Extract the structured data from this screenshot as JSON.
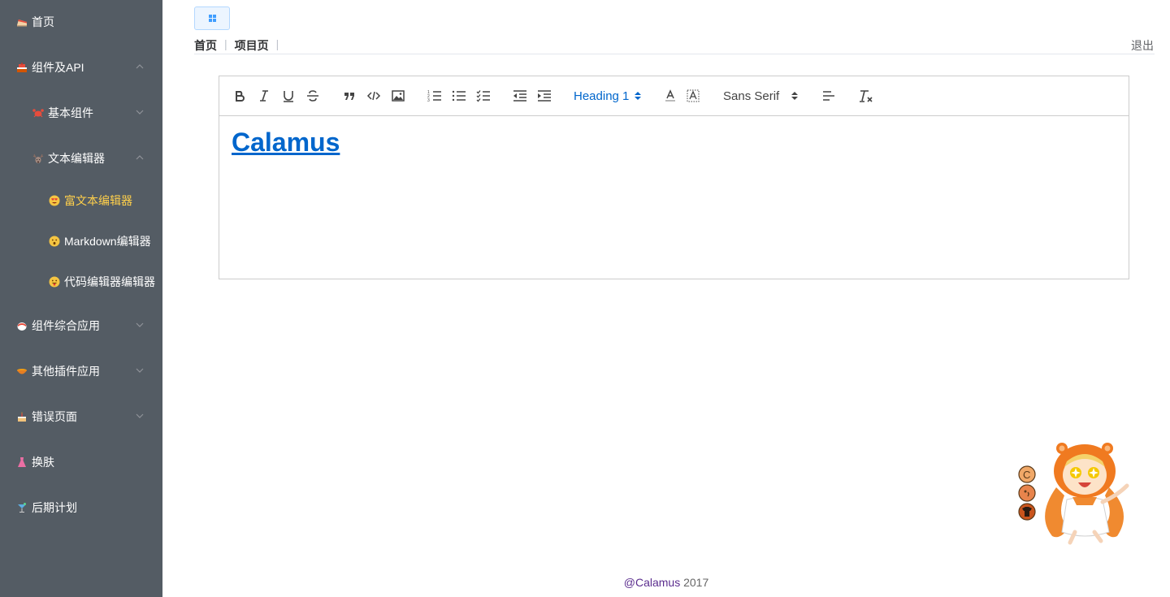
{
  "sidebar": {
    "items": [
      {
        "label": "首页",
        "icon": "cake-slice-icon"
      },
      {
        "label": "组件及API",
        "icon": "cake-icon",
        "expanded": true
      },
      {
        "label": "基本组件",
        "icon": "crab-icon",
        "expanded": false
      },
      {
        "label": "文本编辑器",
        "icon": "deer-icon",
        "expanded": true
      },
      {
        "label": "富文本编辑器",
        "icon": "smiley-heart-eyes-icon",
        "active": true
      },
      {
        "label": "Markdown编辑器",
        "icon": "smiley-surprised-icon"
      },
      {
        "label": "代码编辑器编辑器",
        "icon": "smiley-tongue-icon"
      },
      {
        "label": "组件综合应用",
        "icon": "sushi-icon",
        "expanded": false
      },
      {
        "label": "其他插件应用",
        "icon": "bowl-icon",
        "expanded": false
      },
      {
        "label": "错误页面",
        "icon": "birthday-cake-icon",
        "expanded": false
      },
      {
        "label": "换肤",
        "icon": "dress-icon"
      },
      {
        "label": "后期计划",
        "icon": "cocktail-icon"
      }
    ],
    "colors": {
      "background": "#545c64",
      "text": "#ffffff",
      "active": "#ffd04b"
    }
  },
  "header": {
    "breadcrumb": [
      "首页",
      "项目页"
    ],
    "logout": "退出"
  },
  "editor": {
    "toolbar": {
      "header_select": "Heading 1",
      "font_select": "Sans Serif"
    },
    "content": {
      "heading": "Calamus"
    }
  },
  "footer": {
    "brand": "@Calamus",
    "year": "2017"
  }
}
